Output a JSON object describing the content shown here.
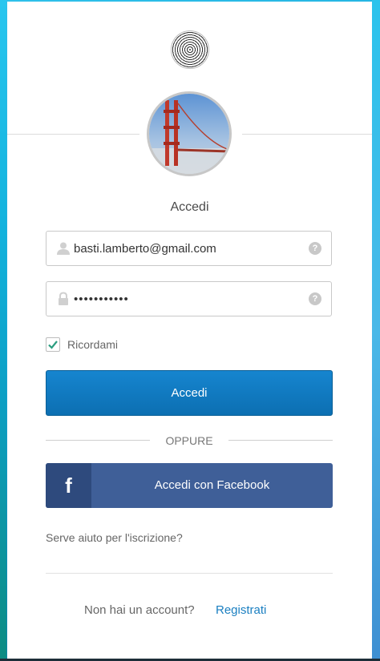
{
  "title": "Accedi",
  "username": {
    "value": "basti.lamberto@gmail.com",
    "help": "?"
  },
  "password": {
    "value": "•••••••••••",
    "help": "?"
  },
  "remember": {
    "label": "Ricordami",
    "checked": true
  },
  "sign_in_button": "Accedi",
  "separator": "OPPURE",
  "facebook": {
    "icon": "f",
    "label": "Accedi con Facebook"
  },
  "help_link": "Serve aiuto per l'iscrizione?",
  "footer": {
    "text": "Non hai un account?",
    "signup": "Registrati"
  },
  "icons": {
    "user": "user-icon",
    "lock": "lock-icon",
    "help": "help-icon",
    "check": "checkmark-icon",
    "facebook": "facebook-icon"
  },
  "colors": {
    "primary_button": "#1078be",
    "facebook_button": "#3f5f98",
    "link": "#1a7fc1",
    "check": "#2a9d7f"
  }
}
